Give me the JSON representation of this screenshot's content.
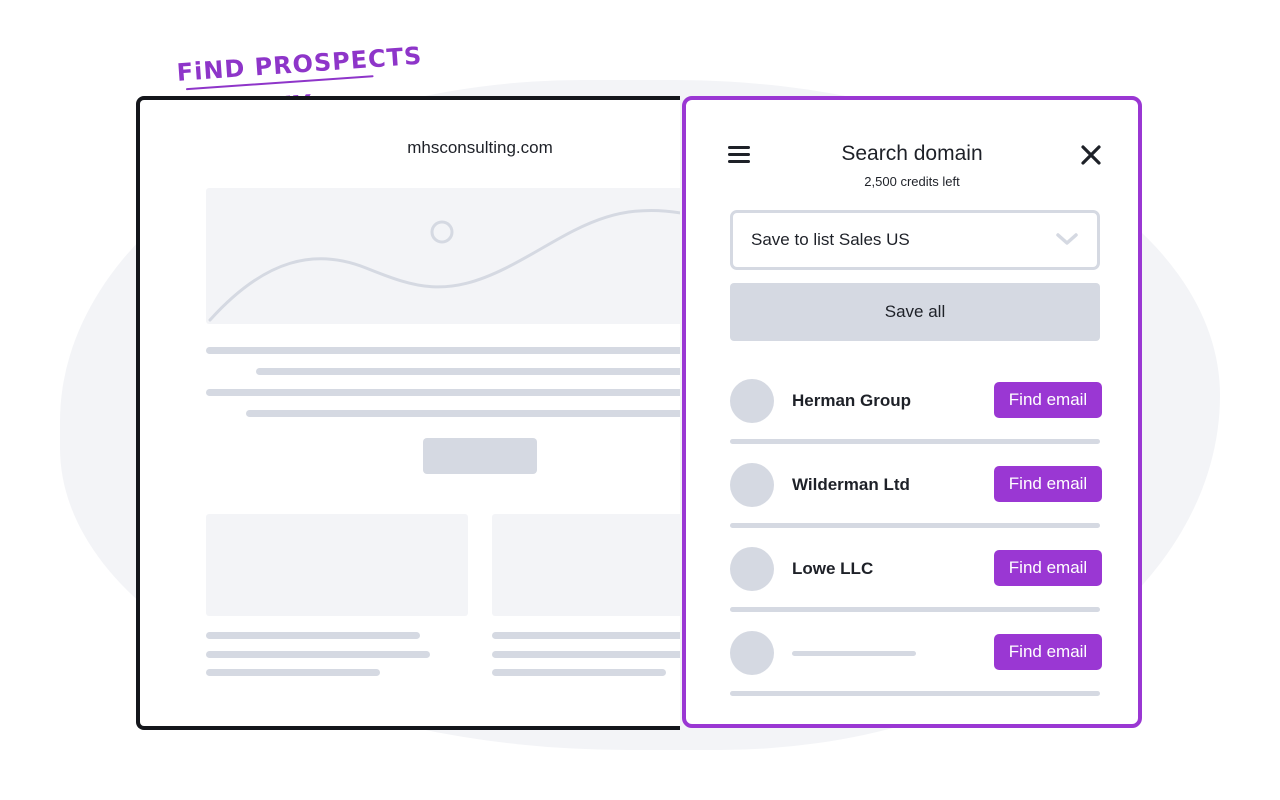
{
  "headline": {
    "line1": "FiND PROSPECTS",
    "line2": "ON ANY WEBSiTE"
  },
  "browser": {
    "domain": "mhsconsulting.com"
  },
  "panel": {
    "title": "Search domain",
    "credits": "2,500 credits left",
    "menu_icon": "hamburger-menu-icon",
    "close_icon": "close-x-icon",
    "list_select": {
      "value": "Save to list Sales US",
      "icon": "chevron-down-icon"
    },
    "save_all_label": "Save all",
    "results": [
      {
        "company": "Herman Group",
        "button": "Find email"
      },
      {
        "company": "Wilderman Ltd",
        "button": "Find email"
      },
      {
        "company": "Lowe LLC",
        "button": "Find email"
      },
      {
        "company": "",
        "button": "Find email"
      }
    ]
  },
  "colors": {
    "accent": "#9a37d3",
    "placeholder": "#d5d9e2",
    "text": "#1e2128",
    "background_blob": "#f3f4f7"
  }
}
